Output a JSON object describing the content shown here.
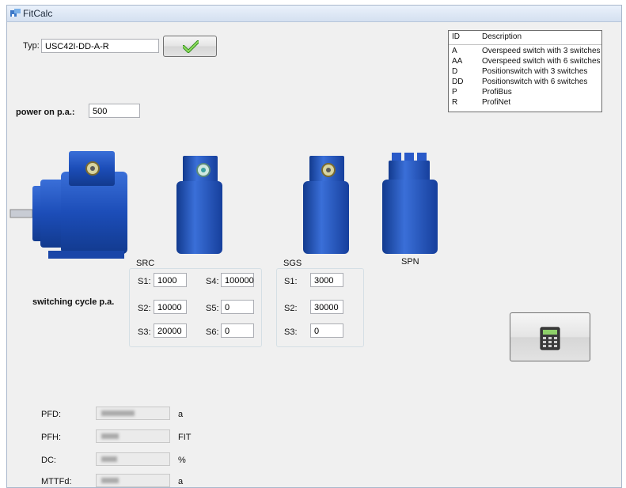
{
  "window": {
    "title": "FitCalc"
  },
  "type_field": {
    "label": "Typ:",
    "value": "USC42I-DD-A-R"
  },
  "power": {
    "label": "power on p.a.:",
    "value": "500"
  },
  "legend": {
    "header_id": "ID",
    "header_desc": "Description",
    "rows": [
      {
        "id": "A",
        "desc": "Overspeed switch with 3 switches"
      },
      {
        "id": "AA",
        "desc": "Overspeed switch with 6 switches"
      },
      {
        "id": "D",
        "desc": "Positionswitch with 3 switches"
      },
      {
        "id": "DD",
        "desc": "Positionswitch with 6 switches"
      },
      {
        "id": "P",
        "desc": "ProfiBus"
      },
      {
        "id": "R",
        "desc": "ProfiNet"
      }
    ]
  },
  "spn_label": "SPN",
  "switching_label": "switching cycle p.a.",
  "src": {
    "title": "SRC",
    "s1_label": "S1:",
    "s1_value": "1000",
    "s2_label": "S2:",
    "s2_value": "10000",
    "s3_label": "S3:",
    "s3_value": "20000",
    "s4_label": "S4:",
    "s4_value": "100000",
    "s5_label": "S5:",
    "s5_value": "0",
    "s6_label": "S6:",
    "s6_value": "0"
  },
  "sgs": {
    "title": "SGS",
    "s1_label": "S1:",
    "s1_value": "3000",
    "s2_label": "S2:",
    "s2_value": "30000",
    "s3_label": "S3:",
    "s3_value": "0"
  },
  "results": [
    {
      "label": "PFD:",
      "unit": "a"
    },
    {
      "label": "PFH:",
      "unit": "FIT"
    },
    {
      "label": "DC:",
      "unit": "%"
    },
    {
      "label": "MTTFd:",
      "unit": "a"
    }
  ],
  "icons": {
    "confirm": "checkmark-icon",
    "calculate": "calculator-icon",
    "app": "fitcalc-app-icon"
  },
  "colors": {
    "motor": "#1d4fb8",
    "check": "#4fb82e",
    "titlebar": "#dbe6f4"
  }
}
